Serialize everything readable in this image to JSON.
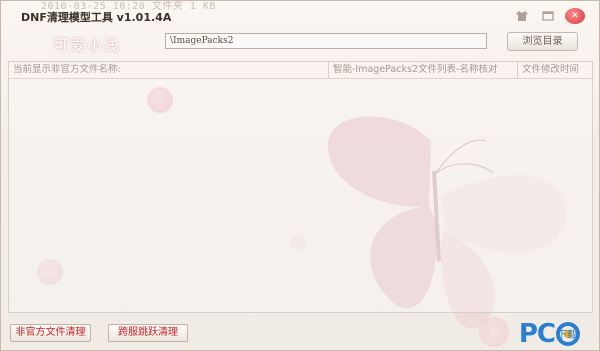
{
  "window": {
    "title": "DNF清理模型工具 v1.01.4A",
    "ghost_text": "2010-03-25 10:20   文件夹   1 KB"
  },
  "title_controls": {
    "skin_icon": "shirt-icon",
    "restore_icon": "window-icon",
    "close_icon": "close-icon"
  },
  "brand": {
    "script_text": "可爱小浅"
  },
  "path_bar": {
    "value": "\\ImagePacks2",
    "browse_label": "浏览目录"
  },
  "list": {
    "columns": [
      "当前显示非官方文件名称:",
      "智能-ImagePacks2文件列表-名称核对",
      "文件修改时间"
    ]
  },
  "actions": {
    "nonofficial_clean": "非官方文件清理",
    "crossserver_clean": "跨服跳跃清理"
  },
  "logo": {
    "text": "PC",
    "cn": "下载"
  },
  "colors": {
    "accent_red": "#d0222a",
    "logo_blue": "#2a7fd0",
    "butterfly_pink": "#e7c4c8"
  }
}
